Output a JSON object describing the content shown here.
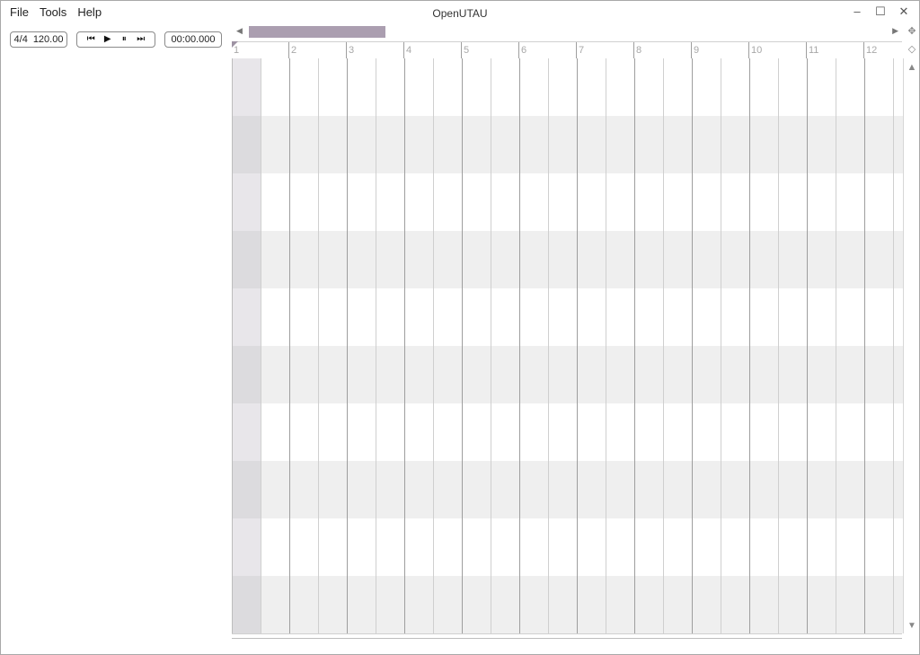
{
  "window": {
    "title": "OpenUTAU",
    "controls": {
      "minimize": "–",
      "maximize": "☐",
      "close": "✕"
    }
  },
  "menu": {
    "items": [
      {
        "label": "File"
      },
      {
        "label": "Tools"
      },
      {
        "label": "Help"
      }
    ]
  },
  "toolbar": {
    "time_signature": "4/4",
    "tempo": "120.00",
    "transport": {
      "first": "⏮",
      "play": "▶",
      "pause": "⏸",
      "last": "⏭"
    },
    "time_display": "00:00.000"
  },
  "timeline": {
    "bar_labels": [
      "1",
      "2",
      "3",
      "4",
      "5",
      "6",
      "7",
      "8",
      "9",
      "10",
      "11",
      "12"
    ],
    "beats_per_bar_lines": 2,
    "track_rows": 10,
    "scroll_left": "◀",
    "scroll_right": "▶",
    "scroll_up": "▲",
    "scroll_down": "▼"
  },
  "colors": {
    "scrollbar_thumb": "#ab9eb0",
    "row_light": "#ffffff",
    "row_dark": "#efefef",
    "header_light": "#e8e6ea",
    "header_dark": "#dcdbde"
  },
  "icons": {
    "nav_top": "move-icon",
    "nav_second": "small-diamond-icon"
  }
}
